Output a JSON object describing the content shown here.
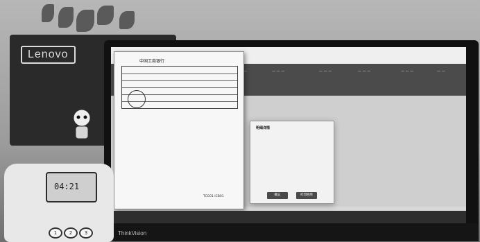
{
  "receipt": {
    "bank_name": "中国工商银行",
    "footer_text": "TCG01 ICB01"
  },
  "modal": {
    "title": "明细详情",
    "ok_label": "确认",
    "cancel_label": "打印回单"
  },
  "monitor": {
    "brand": "ThinkVision"
  },
  "background_monitor": {
    "brand": "Lenovo"
  },
  "phone": {
    "display_value": "04:21",
    "keys": [
      "1",
      "2",
      "3"
    ]
  }
}
